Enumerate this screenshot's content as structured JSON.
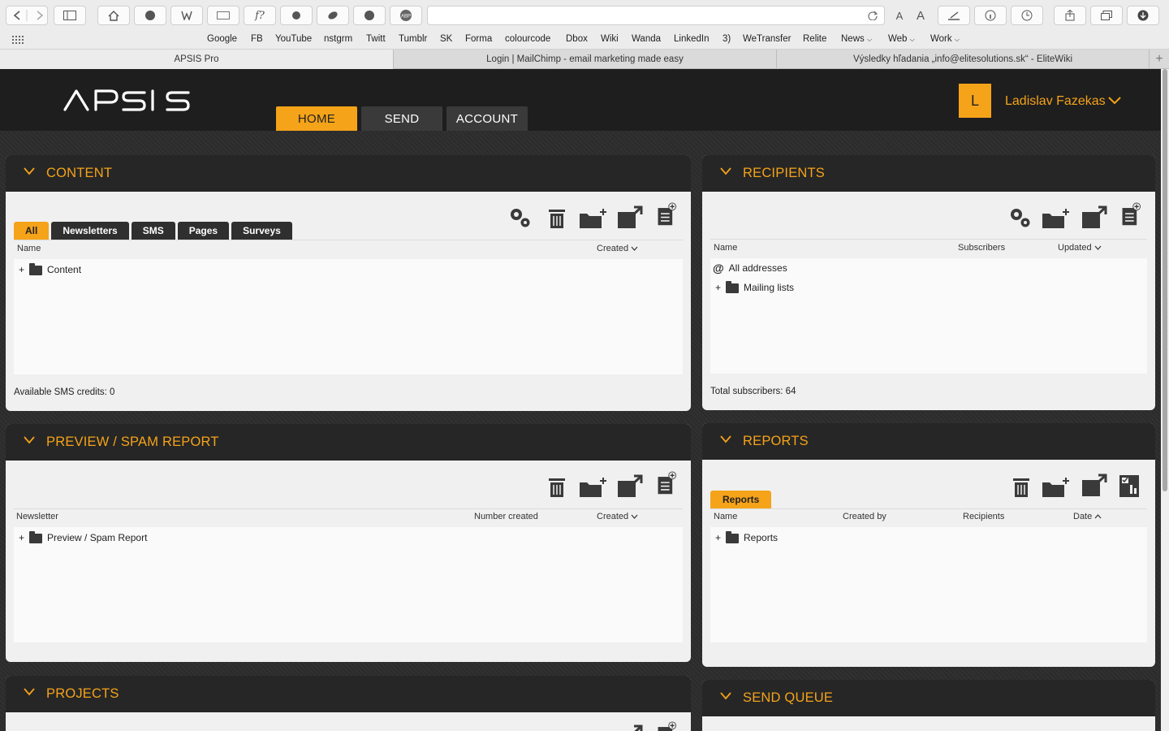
{
  "browser": {
    "bookmarks": [
      "Google",
      "FB",
      "YouTube",
      "nstgrm",
      "Twitt",
      "Tumblr",
      "SK",
      "Forma",
      "colourcode",
      "Dbox",
      "Wiki",
      "Wanda",
      "LinkedIn",
      "3)",
      "WeTransfer",
      "Relite",
      "News",
      "Web",
      "Work"
    ],
    "tabs": [
      "APSIS Pro",
      "Login | MailChimp - email marketing made easy",
      "Výsledky hľadania „info@elitesolutions.sk“ - EliteWiki"
    ],
    "font_small": "A",
    "font_large": "A"
  },
  "app": {
    "logo": "APSIS",
    "nav": [
      "HOME",
      "SEND",
      "ACCOUNT"
    ],
    "avatar_letter": "L",
    "user_name": "Ladislav Fazekas",
    "accent": "#f5a319"
  },
  "content": {
    "title": "CONTENT",
    "tabs": [
      "All",
      "Newsletters",
      "SMS",
      "Pages",
      "Surveys"
    ],
    "col_name": "Name",
    "col_created": "Created",
    "row": "Content",
    "footer": "Available SMS credits: 0"
  },
  "recipients": {
    "title": "RECIPIENTS",
    "col_name": "Name",
    "col_subscribers": "Subscribers",
    "col_updated": "Updated",
    "row1": "All addresses",
    "row2": "Mailing lists",
    "footer": "Total subscribers: 64"
  },
  "preview": {
    "title": "PREVIEW / SPAM REPORT",
    "col_newsletter": "Newsletter",
    "col_number": "Number created",
    "col_created": "Created",
    "row": "Preview / Spam Report"
  },
  "reports": {
    "title": "REPORTS",
    "tab": "Reports",
    "col_name": "Name",
    "col_createdby": "Created by",
    "col_recipients": "Recipients",
    "col_date": "Date",
    "row": "Reports"
  },
  "projects": {
    "title": "PROJECTS"
  },
  "sendqueue": {
    "title": "SEND QUEUE"
  }
}
